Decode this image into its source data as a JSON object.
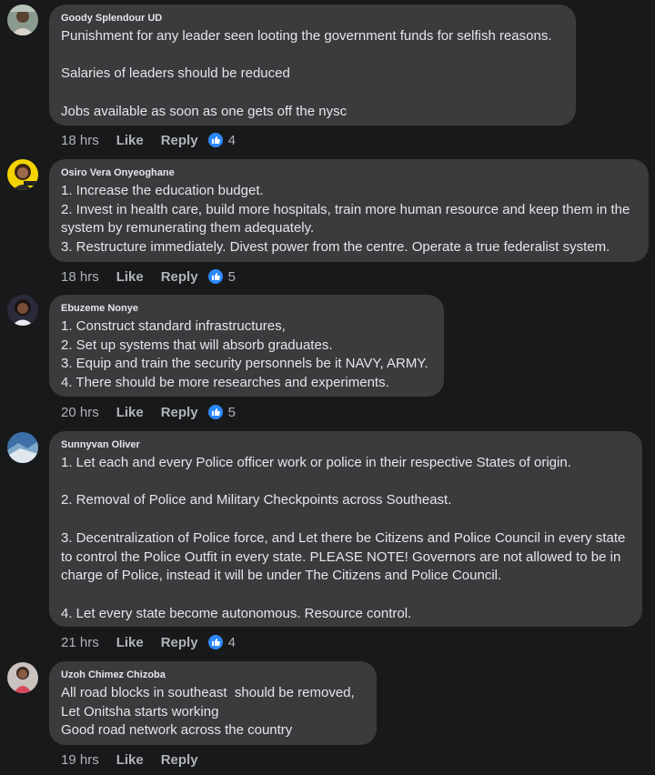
{
  "comments": [
    {
      "author": "Goody Splendour UD",
      "text": "Punishment for any leader seen looting the government funds for selfish reasons.\n\nSalaries of leaders should be reduced\n\nJobs available as soon as one gets off the nysc",
      "time": "18 hrs",
      "like_label": "Like",
      "reply_label": "Reply",
      "reactions": "4",
      "avatar_icon": "profile-photo"
    },
    {
      "author": "Osiro Vera Onyeoghane",
      "text": "1. Increase the education budget.\n2. Invest in health care, build more hospitals, train more human resource and keep them in the\nsystem by remunerating them adequately.\n3. Restructure immediately. Divest power from the centre. Operate a true federalist system.",
      "time": "18 hrs",
      "like_label": "Like",
      "reply_label": "Reply",
      "reactions": "5",
      "avatar_icon": "profile-photo"
    },
    {
      "author": "Ebuzeme Nonye",
      "text": "1. Construct standard infrastructures,\n2. Set up systems that will absorb graduates.\n3. Equip and train the security personnels be it NAVY, ARMY.\n4. There should be more researches and experiments.",
      "time": "20 hrs",
      "like_label": "Like",
      "reply_label": "Reply",
      "reactions": "5",
      "avatar_icon": "profile-photo"
    },
    {
      "author": "Sunnyvan Oliver",
      "text": "1. Let each and every Police officer work or police in their respective States of origin.\n\n2. Removal of Police and Military Checkpoints across Southeast.\n\n3. Decentralization of Police force, and Let there be Citizens and Police Council in every state\nto control the Police Outfit in every state. PLEASE NOTE! Governors are not allowed to be in\ncharge of Police, instead it will be under The Citizens and Police Council.\n\n4. Let every state become autonomous. Resource control.",
      "time": "21 hrs",
      "like_label": "Like",
      "reply_label": "Reply",
      "reactions": "4",
      "avatar_icon": "profile-photo"
    },
    {
      "author": "Uzoh Chimez Chizoba",
      "text": "All road blocks in southeast  should be removed,\nLet Onitsha starts working\nGood road network across the country",
      "time": "19 hrs",
      "like_label": "Like",
      "reply_label": "Reply",
      "avatar_icon": "profile-photo"
    }
  ],
  "colors": {
    "background": "#18191a",
    "bubble": "#3a3b3c",
    "text": "#e4e6eb",
    "secondary": "#b0b3b8",
    "like_blue": "#2d88ff"
  }
}
